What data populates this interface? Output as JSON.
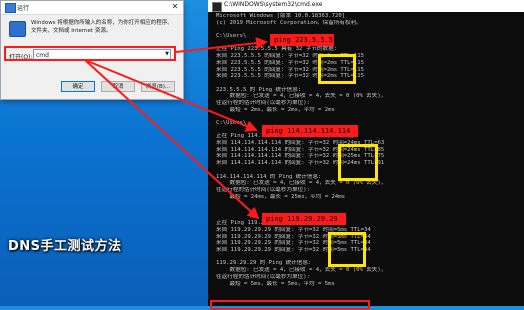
{
  "run_dialog": {
    "title": "运行",
    "close": "✕",
    "description": "Windows 将根据你所输入的名称，为你打开相应的程序、文件夹、文档或 Internet 资源。",
    "open_label": "打开(O):",
    "input_value": "cmd",
    "buttons": {
      "ok": "确定",
      "cancel": "取消",
      "browse": "浏览(B)..."
    }
  },
  "cmd_window": {
    "title": "C:\\WINDOWS\\system32\\cmd.exe",
    "lines": [
      "Microsoft Windows [版本 10.0.18363.720]",
      "(c) 2019 Microsoft Corporation。保留所有权利。",
      "",
      "C:\\Users\\",
      "",
      "正在 Ping 223.5.5.5 具有 32 字节的数据:",
      "来自 223.5.5.5 的回复: 字节=32 时间=2ms TTL=115",
      "来自 223.5.5.5 的回复: 字节=32 时间=2ms TTL=115",
      "来自 223.5.5.5 的回复: 字节=32 时间=2ms TTL=115",
      "来自 223.5.5.5 的回复: 字节=32 时间=2ms TTL=115",
      "",
      "223.5.5.5 的 Ping 统计信息:",
      "    数据包: 已发送 = 4，已接收 = 4，丢失 = 0 (0% 丢失)，",
      "往返行程的估计时间(以毫秒为单位):",
      "    最短 = 2ms，最长 = 2ms，平均 = 2ms",
      "",
      "C:\\Users\\",
      "",
      "正在 Ping 114.114.114.114 具有 32 字节的数据:",
      "来自 114.114.114.114 的回复: 字节=32 时间=24ms TTL=63",
      "来自 114.114.114.114 的回复: 字节=32 时间=24ms TTL=85",
      "来自 114.114.114.114 的回复: 字节=32 时间=25ms TTL=75",
      "来自 114.114.114.114 的回复: 字节=32 时间=24ms TTL=91",
      "",
      "114.114.114.114 的 Ping 统计信息:",
      "    数据包: 已发送 = 4，已接收 = 4，丢失 = 0 (0% 丢失)，",
      "往返行程的估计时间(以毫秒为单位):",
      "    最短 = 24ms，最长 = 25ms，平均 = 24ms",
      "",
      "",
      "",
      "正在 Ping 119.29.29.29 具有 32 字节的数据:",
      "来自 119.29.29.29 的回复: 字节=32 时间=5ms TTL=34",
      "来自 119.29.29.29 的回复: 字节=32 时间=5ms TTL=34",
      "来自 119.29.29.29 的回复: 字节=32 时间=5ms TTL=34",
      "来自 119.29.29.29 的回复: 字节=32 时间=5ms TTL=34",
      "",
      "119.29.29.29 的 Ping 统计信息:",
      "    数据包: 已发送 = 4，已接收 = 4，丢失 = 0 (0% 丢失)，",
      "往返行程的估计时间(以毫秒为单位):",
      "    最短 = 5ms，最长 = 5ms，平均 = 5ms"
    ],
    "ping_commands": [
      "ping 223.5.5.5",
      "ping 114.114.114.114",
      "ping 119.29.29.29"
    ]
  },
  "overlay": {
    "caption": "DNS手工测试方法"
  },
  "colors": {
    "highlight_red": "#ff1a1a",
    "highlight_yellow": "#ffe500",
    "desktop_blue": "#0a73d1"
  }
}
